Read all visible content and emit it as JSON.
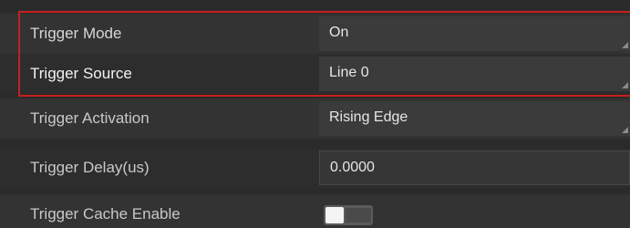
{
  "properties": [
    {
      "label": "Trigger Mode",
      "value": "On",
      "kind": "dropdown"
    },
    {
      "label": "Trigger Source",
      "value": "Line 0",
      "kind": "dropdown"
    },
    {
      "label": "Trigger Activation",
      "value": "Rising Edge",
      "kind": "dropdown"
    },
    {
      "label": "Trigger Delay(us)",
      "value": "0.0000",
      "kind": "text-input"
    },
    {
      "label": "Trigger Cache Enable",
      "value": "off",
      "kind": "toggle"
    }
  ],
  "colors": {
    "highlight_border": "#c81e1e",
    "panel_background": "#2b2b2b"
  },
  "icons": {
    "dropdown_indicator": "dropdown-corner-icon",
    "toggle_knob": "toggle-knob-icon"
  }
}
